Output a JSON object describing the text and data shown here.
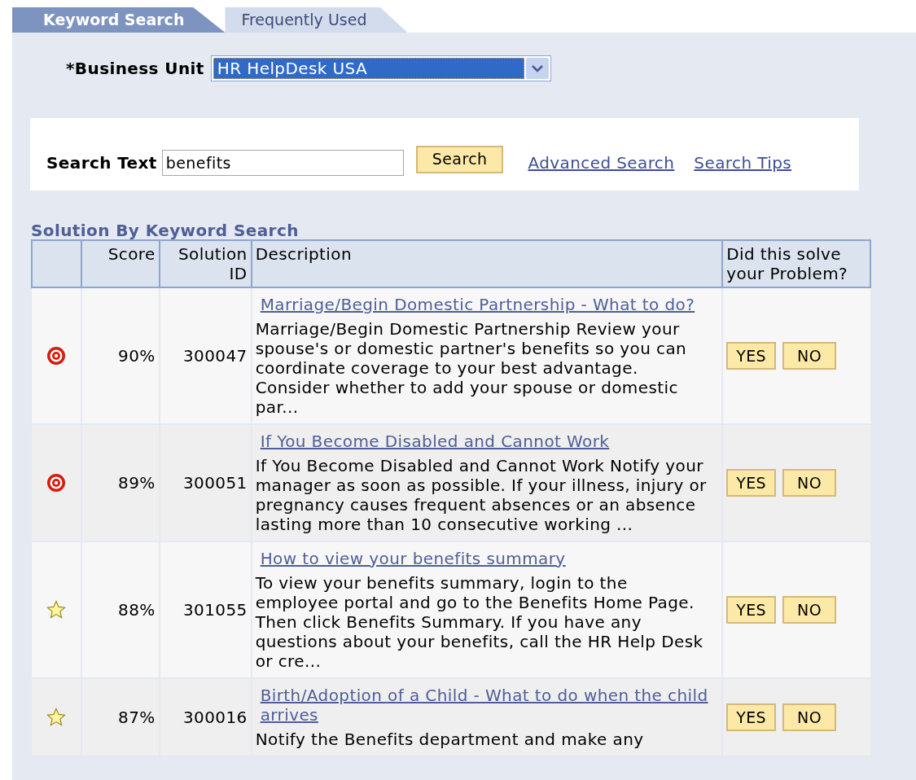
{
  "tabs": [
    {
      "label": "Keyword Search",
      "selected": true
    },
    {
      "label": "Frequently Used",
      "selected": false
    }
  ],
  "business_unit": {
    "label": "*Business Unit",
    "value": "HR HelpDesk USA"
  },
  "search": {
    "label": "Search Text",
    "value": "benefits",
    "button": "Search",
    "links": [
      "Advanced Search",
      "Search Tips"
    ]
  },
  "results": {
    "title": "Solution By Keyword Search",
    "columns": [
      "Score",
      "Solution ID",
      "Description",
      "Did this solve your Problem?"
    ],
    "rows": [
      {
        "kind": "target",
        "score": "90%",
        "id": "300047",
        "title": "Marriage/Begin Domestic Partnership - What to do?",
        "description": "Marriage/Begin Domestic Partnership Review your spouse's or domestic partner's benefits so you can coordinate coverage to your best advantage. Consider whether to add your spouse or domestic par...",
        "buttons": [
          "YES",
          "NO"
        ]
      },
      {
        "kind": "target",
        "score": "89%",
        "id": "300051",
        "title": "If You Become Disabled and Cannot Work",
        "description": "If You Become Disabled and Cannot Work Notify your manager as soon as possible. If your illness, injury or pregnancy causes frequent absences or an absence lasting more than 10 consecutive working ...",
        "buttons": [
          "YES",
          "NO"
        ]
      },
      {
        "kind": "star",
        "score": "88%",
        "id": "301055",
        "title": "How to view your benefits summary",
        "description": "To view your benefits summary, login to the employee portal and go to the Benefits Home Page. Then click Benefits Summary. If you have any questions about your benefits, call the HR Help Desk or cre...",
        "buttons": [
          "YES",
          "NO"
        ]
      },
      {
        "kind": "star",
        "score": "87%",
        "id": "300016",
        "title": "Birth/Adoption of a Child - What to do when the child arrives",
        "description": "Notify the Benefits department and make any",
        "buttons": [
          "YES",
          "NO"
        ]
      }
    ]
  }
}
